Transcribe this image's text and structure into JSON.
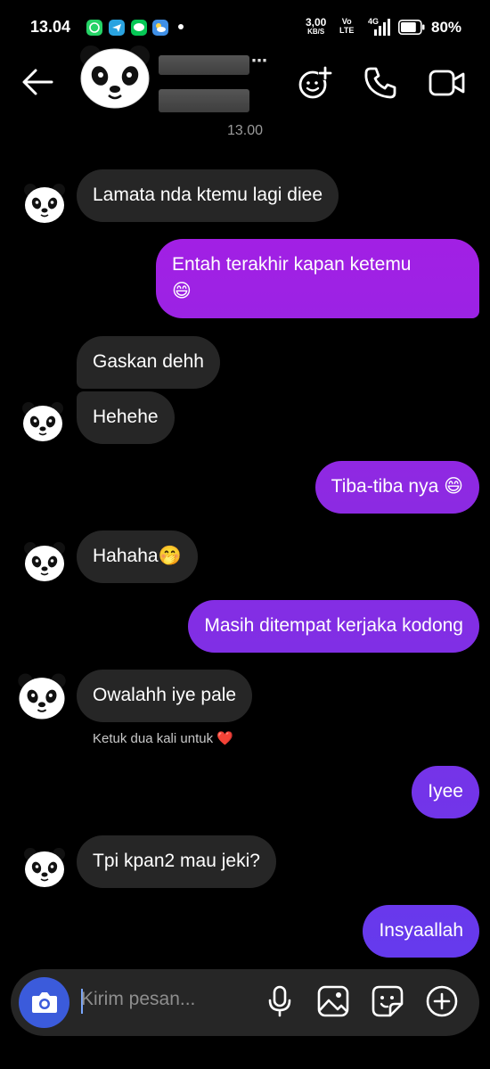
{
  "status_bar": {
    "time": "13.04",
    "speed_value": "3,00",
    "speed_unit": "KB/S",
    "volte_top": "Vo",
    "volte_bottom": "LTE",
    "network": "4G",
    "battery_pct": "80%",
    "battery_level": 0.8,
    "app_icons": [
      "whatsapp-icon",
      "telegram-icon",
      "line-icon",
      "weather-icon"
    ]
  },
  "header": {
    "timestamp": "13.00",
    "more": "⋯"
  },
  "messages": [
    {
      "side": "in",
      "text": "Lamata nda ktemu lagi diee"
    },
    {
      "side": "out",
      "line1": "Entah terakhir kapan ketemu",
      "line2": "😄"
    },
    {
      "side": "in",
      "text": "Gaskan dehh"
    },
    {
      "side": "in",
      "text": "Hehehe"
    },
    {
      "side": "out",
      "text": "Tiba-tiba nya 😄"
    },
    {
      "side": "in",
      "text": "Hahaha🤭"
    },
    {
      "side": "out",
      "text": "Masih ditempat kerjaka kodong"
    },
    {
      "side": "in",
      "text": "Owalahh iye pale"
    },
    {
      "side": "out",
      "text": "Iyee"
    },
    {
      "side": "in",
      "text": "Tpi kpan2 mau jeki?"
    },
    {
      "side": "out",
      "text": "Insyaallah"
    }
  ],
  "reaction_hint": "Ketuk dua kali untuk ❤️",
  "composer": {
    "placeholder": "Kirim pesan..."
  },
  "colors": {
    "bubble_in": "#262626",
    "gradient_magenta": "#b517e6",
    "gradient_violet": "#8a2be2",
    "gradient_indigo": "#5b3ef0",
    "camera_button": "#3b5bdb"
  }
}
